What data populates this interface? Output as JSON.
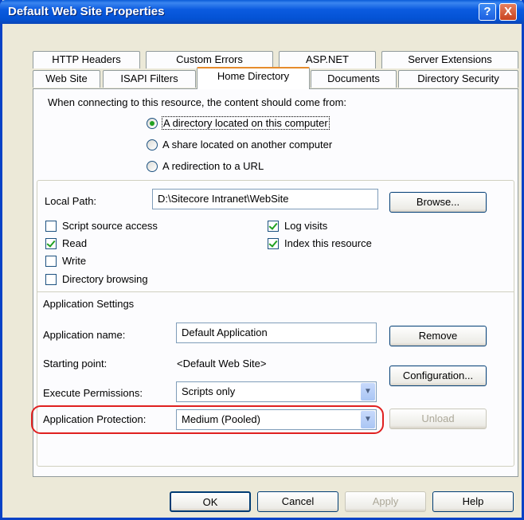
{
  "window": {
    "title": "Default Web Site Properties",
    "help_glyph": "?",
    "close_glyph": "X"
  },
  "tabs": {
    "row1": [
      "HTTP Headers",
      "Custom Errors",
      "ASP.NET",
      "Server Extensions"
    ],
    "row2": [
      "Web Site",
      "ISAPI Filters",
      "Home Directory",
      "Documents",
      "Directory Security"
    ],
    "active": "Home Directory"
  },
  "content_source": {
    "prompt": "When connecting to this resource, the content should come from:",
    "options": [
      "A directory located on this computer",
      "A share located on another computer",
      "A redirection to a URL"
    ],
    "selected_index": 0
  },
  "local_path": {
    "label": "Local Path:",
    "value": "D:\\Sitecore Intranet\\WebSite",
    "browse": "Browse..."
  },
  "permissions": {
    "script_source_access": {
      "label": "Script source access",
      "checked": false
    },
    "read": {
      "label": "Read",
      "checked": true
    },
    "write": {
      "label": "Write",
      "checked": false
    },
    "directory_browsing": {
      "label": "Directory browsing",
      "checked": false
    },
    "log_visits": {
      "label": "Log visits",
      "checked": true
    },
    "index_resource": {
      "label": "Index this resource",
      "checked": true
    }
  },
  "app_settings": {
    "heading": "Application Settings",
    "app_name_label": "Application name:",
    "app_name_value": "Default Application",
    "remove": "Remove",
    "starting_point_label": "Starting point:",
    "starting_point_value": "<Default Web Site>",
    "configuration": "Configuration...",
    "exec_perm_label": "Execute Permissions:",
    "exec_perm_value": "Scripts only",
    "protection_label": "Application Protection:",
    "protection_value": "Medium (Pooled)",
    "unload": "Unload",
    "highlight_color": "#e02020"
  },
  "footer": {
    "ok": "OK",
    "cancel": "Cancel",
    "apply": "Apply",
    "help": "Help"
  },
  "arrow_glyph": "▼"
}
